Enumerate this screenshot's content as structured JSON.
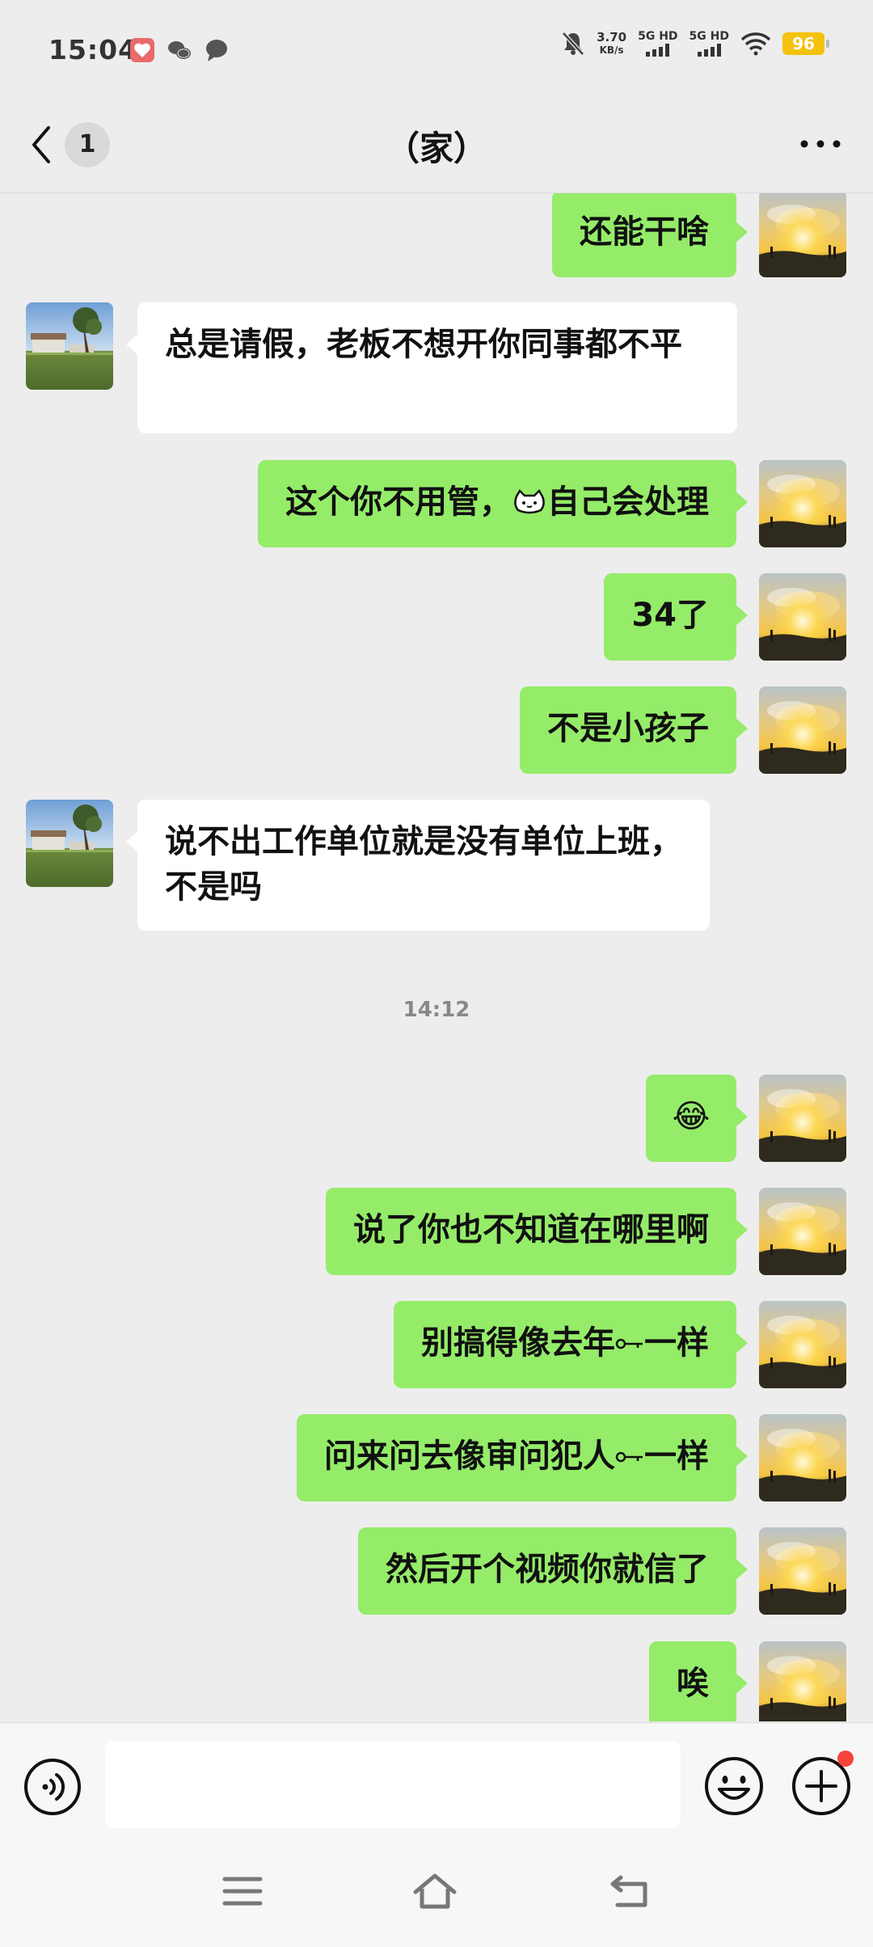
{
  "status_bar": {
    "time": "15:04",
    "net_speed_value": "3.70",
    "net_speed_unit": "KB/s",
    "sim1": "5G HD",
    "sim2": "5G HD",
    "battery": "96",
    "icons": [
      "health-app-icon",
      "wechat-icon",
      "message-bubble-icon",
      "mute-bell-icon",
      "wifi-icon",
      "battery-icon"
    ]
  },
  "header": {
    "back_badge": "1",
    "title": "（家）"
  },
  "messages": [
    {
      "from": "me",
      "text": "还能干啥"
    },
    {
      "from": "them",
      "text": "总是请假，老板不想开你同事都不平"
    },
    {
      "from": "me",
      "text": "这个你不用管，",
      "emoji": "sticker-face-icon",
      "text_after": "自己会处理"
    },
    {
      "from": "me",
      "text": "34了"
    },
    {
      "from": "me",
      "text": "不是小孩子"
    },
    {
      "from": "them",
      "text": "说不出工作单位就是没有单位上班，不是吗"
    },
    {
      "type": "time",
      "text": "14:12"
    },
    {
      "from": "me",
      "text": "😂"
    },
    {
      "from": "me",
      "text": "说了你也不知道在哪里啊"
    },
    {
      "from": "me",
      "text": "别搞得像去年",
      "text_after": "一样"
    },
    {
      "from": "me",
      "text": "问来问去像审问犯人",
      "text_after": "一样"
    },
    {
      "from": "me",
      "text": "然后开个视频你就信了"
    },
    {
      "from": "me",
      "text": "唉"
    }
  ],
  "input_bar": {
    "placeholder": "",
    "icons": [
      "voice-icon",
      "emoji-icon",
      "plus-icon"
    ]
  },
  "nav_bar": {
    "icons": [
      "menu-icon",
      "home-icon",
      "back-icon"
    ]
  },
  "colors": {
    "bubble_me": "#95ec69",
    "bubble_them": "#ffffff",
    "background": "#ededed",
    "battery": "#f4c20d",
    "notification_dot": "#f5443b"
  }
}
